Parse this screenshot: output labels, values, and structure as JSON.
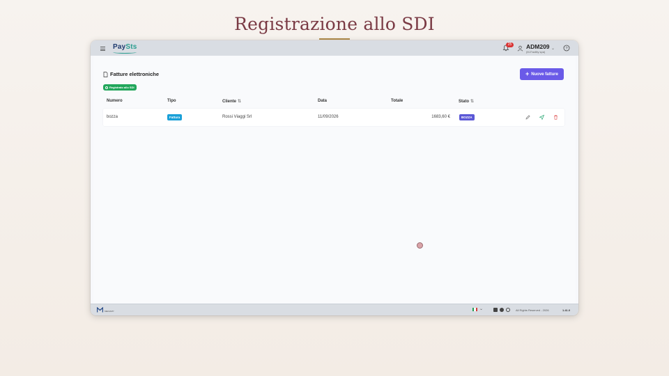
{
  "slide": {
    "title": "Registrazione allo SDI"
  },
  "topbar": {
    "logo_pay": "Pay",
    "logo_sts": "Sts",
    "notifications_count": "25",
    "user_name": "ADM209",
    "user_org": "(M-Facility spa)"
  },
  "page": {
    "heading": "Fatture elettroniche",
    "new_button": "Nuove fatture",
    "sdi_badge": "Registrato allo SDI"
  },
  "table": {
    "headers": {
      "numero": "Numero",
      "tipo": "Tipo",
      "cliente": "Cliente",
      "data": "Data",
      "totale": "Totale",
      "stato": "Stato"
    },
    "rows": [
      {
        "numero": "bozza",
        "tipo": "Fattura",
        "cliente": "Rossi Viaggi Srl",
        "data": "11/09/2026",
        "totale": "1683,60 €",
        "stato": "BOZZA"
      }
    ]
  },
  "footer": {
    "logo_text": "MEDIAPP",
    "rights": "All Rights Reserved - 2026",
    "version": "1.41.0"
  },
  "colors": {
    "primary": "#6a5ae8",
    "sdi_green": "#21a65b",
    "tipo_blue": "#1aa0d8",
    "stato_indigo": "#5b58d6",
    "title": "#7a3a44"
  }
}
